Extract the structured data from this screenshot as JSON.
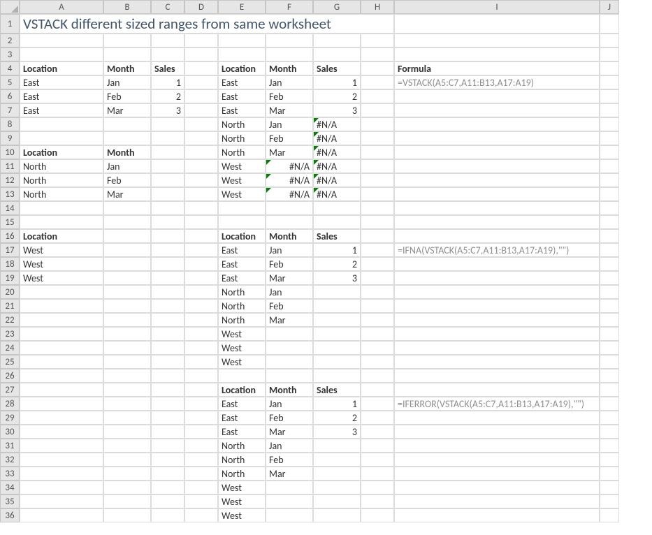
{
  "columns": [
    "A",
    "B",
    "C",
    "D",
    "E",
    "F",
    "G",
    "H",
    "I",
    "J"
  ],
  "rowCount": 36,
  "title": "VSTACK different sized ranges from same worksheet",
  "cells": {
    "A1": {
      "v": "VSTACK different sized ranges from same worksheet",
      "cls": "title-cell",
      "span": 8
    },
    "A4": {
      "v": "Location",
      "cls": "bold"
    },
    "B4": {
      "v": "Month",
      "cls": "bold"
    },
    "C4": {
      "v": "Sales",
      "cls": "bold"
    },
    "E4": {
      "v": "Location",
      "cls": "bold"
    },
    "F4": {
      "v": "Month",
      "cls": "bold"
    },
    "G4": {
      "v": "Sales",
      "cls": "bold"
    },
    "I4": {
      "v": "Formula",
      "cls": "bold"
    },
    "A5": {
      "v": "East"
    },
    "B5": {
      "v": "Jan"
    },
    "C5": {
      "v": "1",
      "cls": "right"
    },
    "A6": {
      "v": "East"
    },
    "B6": {
      "v": "Feb"
    },
    "C6": {
      "v": "2",
      "cls": "right"
    },
    "A7": {
      "v": "East"
    },
    "B7": {
      "v": "Mar"
    },
    "C7": {
      "v": "3",
      "cls": "right"
    },
    "E5": {
      "v": "East"
    },
    "F5": {
      "v": "Jan"
    },
    "G5": {
      "v": "1",
      "cls": "right"
    },
    "E6": {
      "v": "East"
    },
    "F6": {
      "v": "Feb"
    },
    "G6": {
      "v": "2",
      "cls": "right"
    },
    "E7": {
      "v": "East"
    },
    "F7": {
      "v": "Mar"
    },
    "G7": {
      "v": "3",
      "cls": "right"
    },
    "E8": {
      "v": "North"
    },
    "F8": {
      "v": "Jan"
    },
    "G8": {
      "v": "#N/A",
      "cls": "err-marker"
    },
    "E9": {
      "v": "North"
    },
    "F9": {
      "v": "Feb"
    },
    "G9": {
      "v": "#N/A",
      "cls": "err-marker"
    },
    "E10": {
      "v": "North"
    },
    "F10": {
      "v": "Mar"
    },
    "G10": {
      "v": "#N/A",
      "cls": "err-marker"
    },
    "E11": {
      "v": "West"
    },
    "F11": {
      "v": "#N/A",
      "cls": "right err-marker"
    },
    "G11": {
      "v": "#N/A",
      "cls": "err-marker"
    },
    "E12": {
      "v": "West"
    },
    "F12": {
      "v": "#N/A",
      "cls": "right err-marker"
    },
    "G12": {
      "v": "#N/A",
      "cls": "err-marker"
    },
    "E13": {
      "v": "West"
    },
    "F13": {
      "v": "#N/A",
      "cls": "right err-marker"
    },
    "G13": {
      "v": "#N/A",
      "cls": "err-marker"
    },
    "I5": {
      "v": "=VSTACK(A5:C7,A11:B13,A17:A19)",
      "cls": "formula"
    },
    "A10": {
      "v": "Location",
      "cls": "bold"
    },
    "B10": {
      "v": "Month",
      "cls": "bold"
    },
    "A11": {
      "v": "North"
    },
    "B11": {
      "v": "Jan"
    },
    "A12": {
      "v": "North"
    },
    "B12": {
      "v": "Feb"
    },
    "A13": {
      "v": "North"
    },
    "B13": {
      "v": "Mar"
    },
    "A16": {
      "v": "Location",
      "cls": "bold"
    },
    "A17": {
      "v": "West"
    },
    "A18": {
      "v": "West"
    },
    "A19": {
      "v": "West"
    },
    "E16": {
      "v": "Location",
      "cls": "bold"
    },
    "F16": {
      "v": "Month",
      "cls": "bold"
    },
    "G16": {
      "v": "Sales",
      "cls": "bold"
    },
    "E17": {
      "v": "East"
    },
    "F17": {
      "v": "Jan"
    },
    "G17": {
      "v": "1",
      "cls": "right"
    },
    "E18": {
      "v": "East"
    },
    "F18": {
      "v": "Feb"
    },
    "G18": {
      "v": "2",
      "cls": "right"
    },
    "E19": {
      "v": "East"
    },
    "F19": {
      "v": "Mar"
    },
    "G19": {
      "v": "3",
      "cls": "right"
    },
    "E20": {
      "v": "North"
    },
    "F20": {
      "v": "Jan"
    },
    "E21": {
      "v": "North"
    },
    "F21": {
      "v": "Feb"
    },
    "E22": {
      "v": "North"
    },
    "F22": {
      "v": "Mar"
    },
    "E23": {
      "v": "West"
    },
    "E24": {
      "v": "West"
    },
    "E25": {
      "v": "West"
    },
    "I17": {
      "v": "=IFNA(VSTACK(A5:C7,A11:B13,A17:A19),\"\")",
      "cls": "formula"
    },
    "E27": {
      "v": "Location",
      "cls": "bold"
    },
    "F27": {
      "v": "Month",
      "cls": "bold"
    },
    "G27": {
      "v": "Sales",
      "cls": "bold"
    },
    "E28": {
      "v": "East"
    },
    "F28": {
      "v": "Jan"
    },
    "G28": {
      "v": "1",
      "cls": "right"
    },
    "E29": {
      "v": "East"
    },
    "F29": {
      "v": "Feb"
    },
    "G29": {
      "v": "2",
      "cls": "right"
    },
    "E30": {
      "v": "East"
    },
    "F30": {
      "v": "Mar"
    },
    "G30": {
      "v": "3",
      "cls": "right"
    },
    "E31": {
      "v": "North"
    },
    "F31": {
      "v": "Jan"
    },
    "E32": {
      "v": "North"
    },
    "F32": {
      "v": "Feb"
    },
    "E33": {
      "v": "North"
    },
    "F33": {
      "v": "Mar"
    },
    "E34": {
      "v": "West"
    },
    "E35": {
      "v": "West"
    },
    "E36": {
      "v": "West"
    },
    "I28": {
      "v": "=IFERROR(VSTACK(A5:C7,A11:B13,A17:A19),\"\")",
      "cls": "formula"
    }
  },
  "chart_data": {
    "type": "table",
    "title": "VSTACK different sized ranges from same worksheet",
    "source_ranges": [
      {
        "range": "A5:C7",
        "headers": [
          "Location",
          "Month",
          "Sales"
        ],
        "rows": [
          [
            "East",
            "Jan",
            1
          ],
          [
            "East",
            "Feb",
            2
          ],
          [
            "East",
            "Mar",
            3
          ]
        ]
      },
      {
        "range": "A11:B13",
        "headers": [
          "Location",
          "Month"
        ],
        "rows": [
          [
            "North",
            "Jan"
          ],
          [
            "North",
            "Feb"
          ],
          [
            "North",
            "Mar"
          ]
        ]
      },
      {
        "range": "A17:A19",
        "headers": [
          "Location"
        ],
        "rows": [
          [
            "West"
          ],
          [
            "West"
          ],
          [
            "West"
          ]
        ]
      }
    ],
    "examples": [
      {
        "formula": "=VSTACK(A5:C7,A11:B13,A17:A19)",
        "headers": [
          "Location",
          "Month",
          "Sales"
        ],
        "rows": [
          [
            "East",
            "Jan",
            1
          ],
          [
            "East",
            "Feb",
            2
          ],
          [
            "East",
            "Mar",
            3
          ],
          [
            "North",
            "Jan",
            "#N/A"
          ],
          [
            "North",
            "Feb",
            "#N/A"
          ],
          [
            "North",
            "Mar",
            "#N/A"
          ],
          [
            "West",
            "#N/A",
            "#N/A"
          ],
          [
            "West",
            "#N/A",
            "#N/A"
          ],
          [
            "West",
            "#N/A",
            "#N/A"
          ]
        ]
      },
      {
        "formula": "=IFNA(VSTACK(A5:C7,A11:B13,A17:A19),\"\")",
        "headers": [
          "Location",
          "Month",
          "Sales"
        ],
        "rows": [
          [
            "East",
            "Jan",
            1
          ],
          [
            "East",
            "Feb",
            2
          ],
          [
            "East",
            "Mar",
            3
          ],
          [
            "North",
            "Jan",
            ""
          ],
          [
            "North",
            "Feb",
            ""
          ],
          [
            "North",
            "Mar",
            ""
          ],
          [
            "West",
            "",
            ""
          ],
          [
            "West",
            "",
            ""
          ],
          [
            "West",
            "",
            ""
          ]
        ]
      },
      {
        "formula": "=IFERROR(VSTACK(A5:C7,A11:B13,A17:A19),\"\")",
        "headers": [
          "Location",
          "Month",
          "Sales"
        ],
        "rows": [
          [
            "East",
            "Jan",
            1
          ],
          [
            "East",
            "Feb",
            2
          ],
          [
            "East",
            "Mar",
            3
          ],
          [
            "North",
            "Jan",
            ""
          ],
          [
            "North",
            "Feb",
            ""
          ],
          [
            "North",
            "Mar",
            ""
          ],
          [
            "West",
            "",
            ""
          ],
          [
            "West",
            "",
            ""
          ],
          [
            "West",
            "",
            ""
          ]
        ]
      }
    ]
  }
}
